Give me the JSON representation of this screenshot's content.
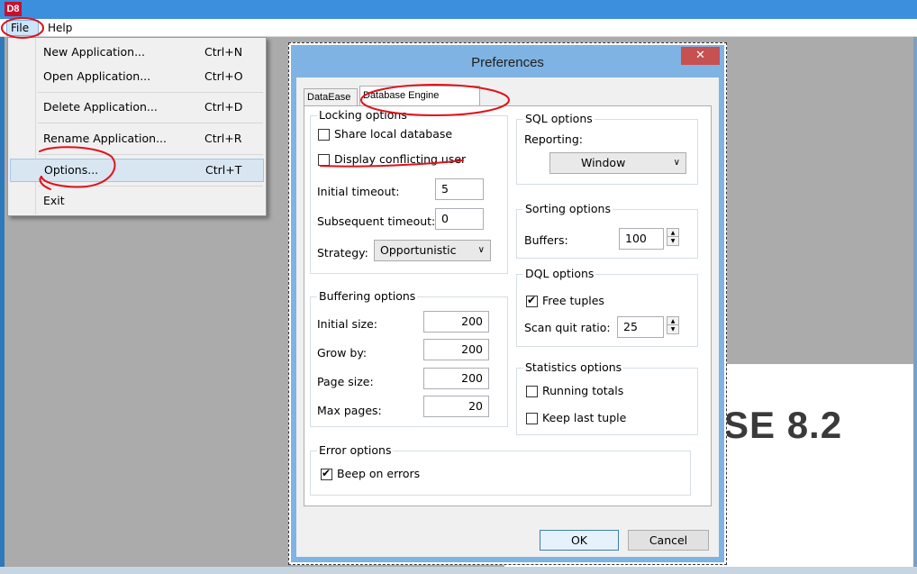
{
  "app": {
    "icon_text": "D8"
  },
  "menubar": {
    "file": "File",
    "help": "Help"
  },
  "file_menu": {
    "items": [
      {
        "label": "New Application...",
        "accel": "Ctrl+N"
      },
      {
        "label": "Open Application...",
        "accel": "Ctrl+O"
      },
      {
        "label": "Delete Application...",
        "accel": "Ctrl+D"
      },
      {
        "label": "Rename Application...",
        "accel": "Ctrl+R"
      },
      {
        "label": "Options...",
        "accel": "Ctrl+T"
      },
      {
        "label": "Exit",
        "accel": ""
      }
    ]
  },
  "background": {
    "splash_title": "SE 8.2"
  },
  "dialog": {
    "title": "Preferences",
    "close_glyph": "✕",
    "tabs": [
      "DataEase",
      "Database Engine"
    ],
    "locking": {
      "title": "Locking options",
      "share_local": "Share local database",
      "display_conflicting": "Display conflicting user",
      "initial_timeout_label": "Initial timeout:",
      "initial_timeout": "5",
      "subsequent_timeout_label": "Subsequent timeout:",
      "subsequent_timeout": "0",
      "strategy_label": "Strategy:",
      "strategy": "Opportunistic"
    },
    "buffering": {
      "title": "Buffering options",
      "initial_size_label": "Initial size:",
      "initial_size": "200",
      "grow_by_label": "Grow by:",
      "grow_by": "200",
      "page_size_label": "Page size:",
      "page_size": "200",
      "max_pages_label": "Max pages:",
      "max_pages": "20"
    },
    "error": {
      "title": "Error options",
      "beep": "Beep on errors"
    },
    "sql": {
      "title": "SQL options",
      "reporting_label": "Reporting:",
      "reporting": "Window"
    },
    "sorting": {
      "title": "Sorting options",
      "buffers_label": "Buffers:",
      "buffers": "100"
    },
    "dql": {
      "title": "DQL options",
      "free_tuples": "Free tuples",
      "scan_quit_label": "Scan quit ratio:",
      "scan_quit": "25"
    },
    "stats": {
      "title": "Statistics options",
      "running_totals": "Running totals",
      "keep_last": "Keep last tuple"
    },
    "ok": "OK",
    "cancel": "Cancel"
  },
  "colors": {
    "accent": "#3c8fdd",
    "annotation": "#e0111b",
    "dialog_frame": "#7fb3e3"
  }
}
